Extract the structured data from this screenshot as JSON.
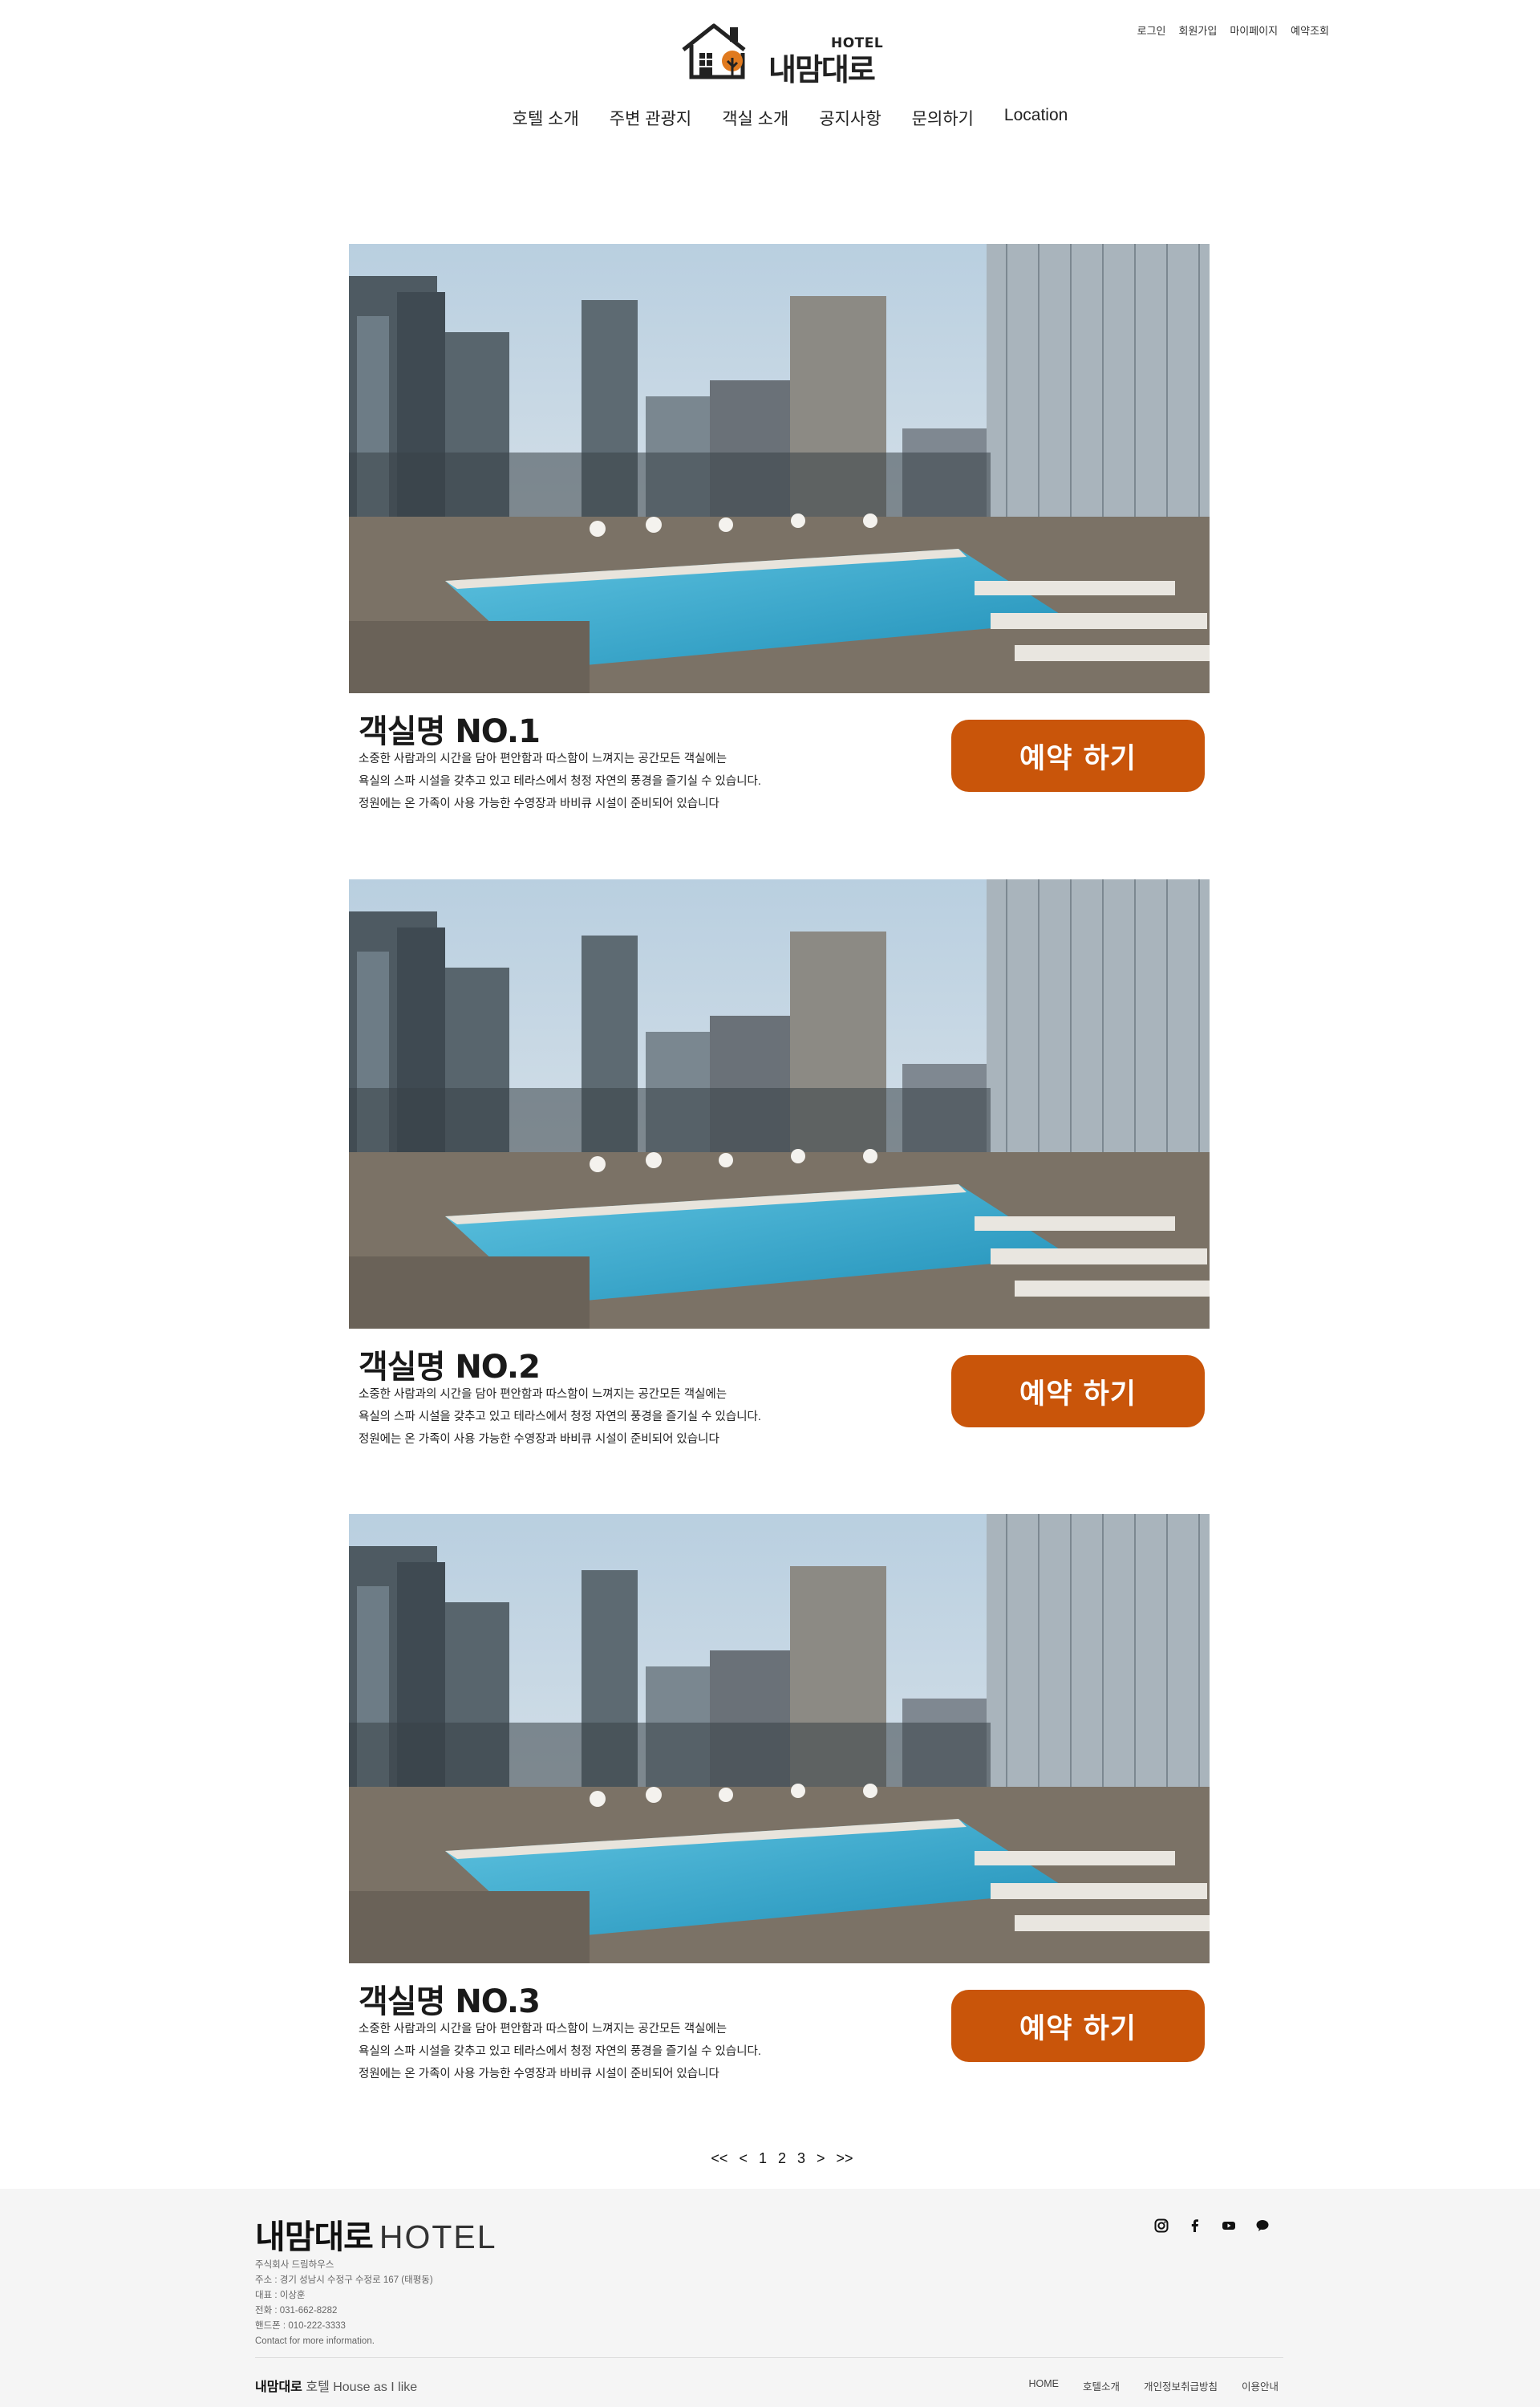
{
  "header": {
    "util_links": [
      "로그인",
      "회원가입",
      "마이페이지",
      "예약조회"
    ],
    "logo": {
      "tag": "HOTEL",
      "name": "내맘대로"
    },
    "nav": [
      "호텔 소개",
      "주변 관광지",
      "객실 소개",
      "공지사항",
      "문의하기",
      "Location"
    ]
  },
  "rooms": [
    {
      "title": "객실명 NO.1",
      "desc": [
        "소중한 사람과의 시간을 담아 편안함과 따스함이 느껴지는 공간모든 객실에는",
        "욕실의 스파 시설을 갖추고 있고 테라스에서 청정 자연의 풍경을 즐기실 수 있습니다.",
        "정원에는 온 가족이 사용 가능한 수영장과 바비큐 시설이 준비되어 있습니다"
      ],
      "button": "예약 하기"
    },
    {
      "title": "객실명 NO.2",
      "desc": [
        "소중한 사람과의 시간을 담아 편안함과 따스함이 느껴지는 공간모든 객실에는",
        "욕실의 스파 시설을 갖추고 있고 테라스에서 청정 자연의 풍경을 즐기실 수 있습니다.",
        "정원에는 온 가족이 사용 가능한 수영장과 바비큐 시설이 준비되어 있습니다"
      ],
      "button": "예약 하기"
    },
    {
      "title": "객실명 NO.3",
      "desc": [
        "소중한 사람과의 시간을 담아 편안함과 따스함이 느껴지는 공간모든 객실에는",
        "욕실의 스파 시설을 갖추고 있고 테라스에서 청정 자연의 풍경을 즐기실 수 있습니다.",
        "정원에는 온 가족이 사용 가능한 수영장과 바비큐 시설이 준비되어 있습니다"
      ],
      "button": "예약 하기"
    }
  ],
  "pagination": [
    "<<",
    "<",
    "1",
    "2",
    "3",
    ">",
    ">>"
  ],
  "footer": {
    "logo_bold": "내맘대로",
    "logo_light": "HOTEL",
    "info": [
      "주식회사 드림하우스",
      "주소 : 경기 성남시 수정구 수정로 167 (태평동)",
      "대표 : 이상훈",
      "전화 : 031-662-8282",
      "핸드폰 : 010-222-3333",
      "Contact for more information."
    ],
    "social": [
      "instagram-icon",
      "facebook-icon",
      "youtube-icon",
      "kakaotalk-icon"
    ],
    "slogan_bold": "내맘대로",
    "slogan_rest": "호텔 House as I like",
    "links": [
      "HOME",
      "호텔소개",
      "개인정보취급방침",
      "이용안내"
    ]
  },
  "colors": {
    "accent": "#c9550a",
    "footer_bg": "#f5f5f5"
  }
}
